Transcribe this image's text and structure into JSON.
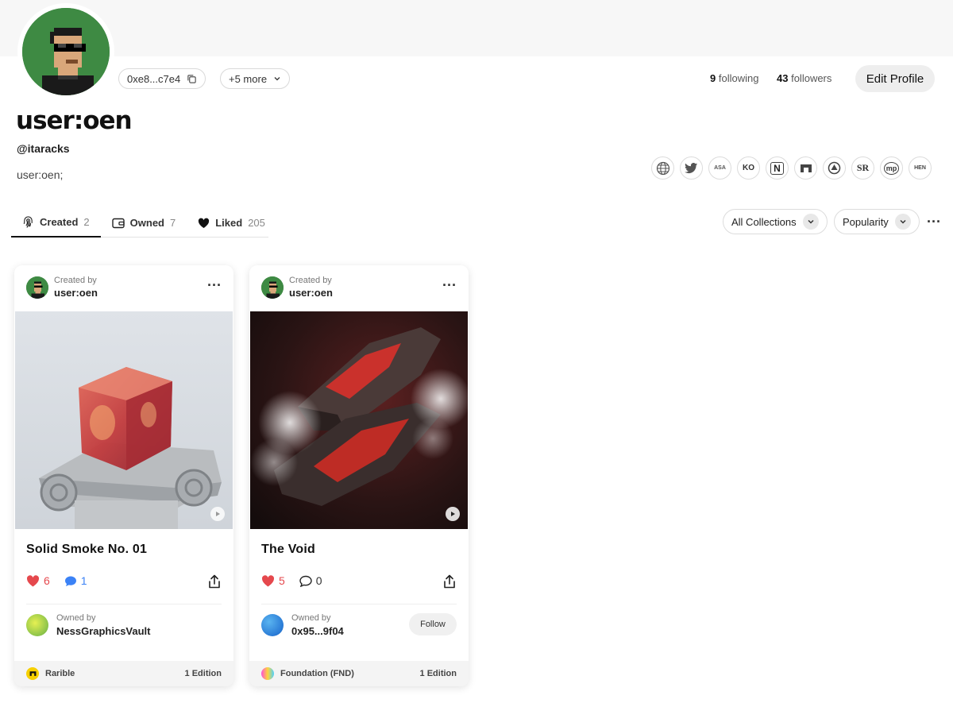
{
  "profile": {
    "address": "0xe8...c7e4",
    "more": "+5 more",
    "following_count": "9",
    "following_label": "following",
    "followers_count": "43",
    "followers_label": "followers",
    "edit_label": "Edit Profile",
    "display_name": "user:oen",
    "handle": "@itaracks",
    "bio": "user:oen;"
  },
  "socials": [
    {
      "icon": "globe-icon",
      "text": ""
    },
    {
      "icon": "twitter-icon",
      "text": ""
    },
    {
      "icon": "async-icon",
      "text": "ASA"
    },
    {
      "icon": "known-origin-icon",
      "text": "KO"
    },
    {
      "icon": "notion-icon",
      "text": "N"
    },
    {
      "icon": "rarible-icon",
      "text": ""
    },
    {
      "icon": "zora-icon",
      "text": ""
    },
    {
      "icon": "superrare-icon",
      "text": "SR"
    },
    {
      "icon": "makersplace-icon",
      "text": "mp"
    },
    {
      "icon": "hen-icon",
      "text": "HEN"
    }
  ],
  "tabs": [
    {
      "label": "Created",
      "count": "2"
    },
    {
      "label": "Owned",
      "count": "7"
    },
    {
      "label": "Liked",
      "count": "205"
    }
  ],
  "filters": {
    "collections": "All Collections",
    "sort": "Popularity"
  },
  "cards": [
    {
      "created_by_label": "Created by",
      "creator": "user:oen",
      "title": "Solid Smoke No. 01",
      "likes": "6",
      "comments": "1",
      "owned_by_label": "Owned by",
      "owner": "NessGraphicsVault",
      "platform": "Rarible",
      "editions": "1 Edition"
    },
    {
      "created_by_label": "Created by",
      "creator": "user:oen",
      "title": "The Void",
      "likes": "5",
      "comments": "0",
      "owned_by_label": "Owned by",
      "owner": "0x95...9f04",
      "follow_label": "Follow",
      "platform": "Foundation (FND)",
      "editions": "1 Edition"
    }
  ],
  "colors": {
    "accent_like": "#e5484d",
    "accent_comment": "#3b82f6",
    "avatar_bg": "#3e8a43"
  }
}
